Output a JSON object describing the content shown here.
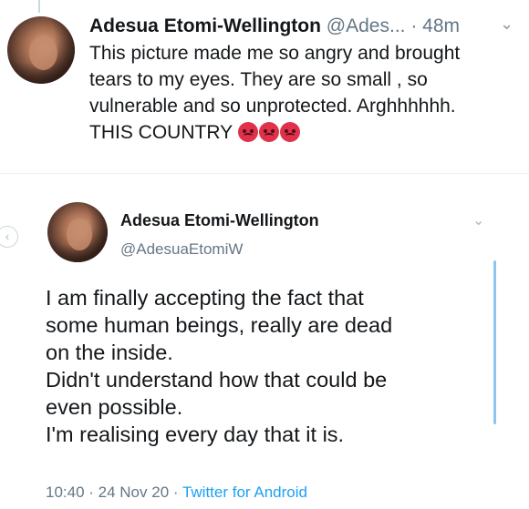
{
  "first_tweet": {
    "author_name": "Adesua Etomi-Wellington",
    "handle": "@Ades...",
    "time": "· 48m",
    "text_lines": [
      "This picture made me so angry and brought",
      "tears to my eyes. They are so small , so",
      "vulnerable and so unprotected. Arghhhhhh.",
      "THIS COUNTRY"
    ],
    "emojis": [
      "angry-face-icon",
      "angry-face-icon",
      "angry-face-icon"
    ]
  },
  "second_tweet": {
    "author_name": "Adesua Etomi-Wellington",
    "handle": "@AdesuaEtomiW",
    "text_lines": [
      "I am finally accepting the fact that",
      "some human beings, really are dead",
      "on the inside.",
      "Didn't understand how that could be",
      "even possible.",
      "I'm realising every day that it is."
    ],
    "timestamp": "10:40 · 24 Nov 20 · ",
    "source": "Twitter for Android"
  },
  "colors": {
    "link": "#1da1f2",
    "muted": "#657786",
    "emoji": "#e0304a"
  }
}
